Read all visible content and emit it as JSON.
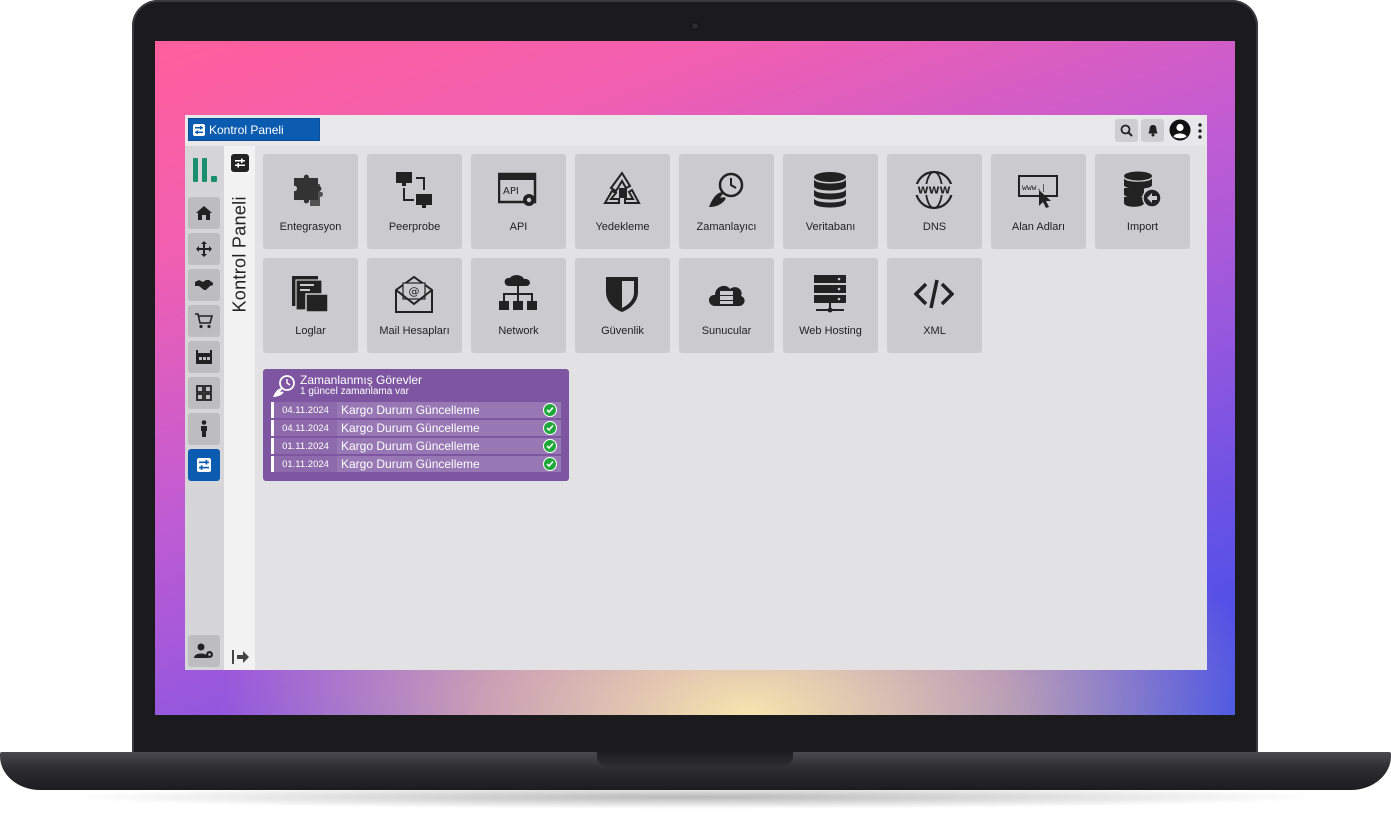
{
  "header": {
    "breadcrumb": "Kontrol Paneli"
  },
  "sidebar": {
    "title": "Kontrol Paneli",
    "items": [
      {
        "icon": "home-icon"
      },
      {
        "icon": "move-icon"
      },
      {
        "icon": "handshake-icon"
      },
      {
        "icon": "cart-icon"
      },
      {
        "icon": "warehouse-icon"
      },
      {
        "icon": "grid-icon"
      },
      {
        "icon": "person-icon"
      },
      {
        "icon": "control-panel-icon",
        "active": true
      }
    ],
    "bottom_icon": "user-settings-icon"
  },
  "modules": [
    {
      "label": "Entegrasyon",
      "icon": "puzzle-icon"
    },
    {
      "label": "Peerprobe",
      "icon": "network-monitors-icon"
    },
    {
      "label": "API",
      "icon": "api-icon"
    },
    {
      "label": "Yedekleme",
      "icon": "recycle-icon"
    },
    {
      "label": "Zamanlayıcı",
      "icon": "scheduler-icon"
    },
    {
      "label": "Veritabanı",
      "icon": "database-icon"
    },
    {
      "label": "DNS",
      "icon": "www-globe-icon"
    },
    {
      "label": "Alan Adları",
      "icon": "domain-icon"
    },
    {
      "label": "Import",
      "icon": "database-import-icon"
    },
    {
      "label": "Loglar",
      "icon": "logs-icon"
    },
    {
      "label": "Mail Hesapları",
      "icon": "mail-icon"
    },
    {
      "label": "Network",
      "icon": "network-tree-icon"
    },
    {
      "label": "Güvenlik",
      "icon": "shield-icon"
    },
    {
      "label": "Sunucular",
      "icon": "cloud-server-icon"
    },
    {
      "label": "Web Hosting",
      "icon": "server-rack-icon"
    },
    {
      "label": "XML",
      "icon": "code-icon"
    }
  ],
  "scheduled": {
    "title": "Zamanlanmış Görevler",
    "subtitle": "1 güncel zamanlama var",
    "rows": [
      {
        "date": "04.11.2024",
        "task": "Kargo Durum Güncelleme"
      },
      {
        "date": "04.11.2024",
        "task": "Kargo Durum Güncelleme"
      },
      {
        "date": "01.11.2024",
        "task": "Kargo Durum Güncelleme"
      },
      {
        "date": "01.11.2024",
        "task": "Kargo Durum Güncelleme"
      }
    ]
  },
  "colors": {
    "accent": "#0b5cb0",
    "panel": "#7d55a0",
    "success": "#1fa83a",
    "logo": "#1a8f6e"
  }
}
